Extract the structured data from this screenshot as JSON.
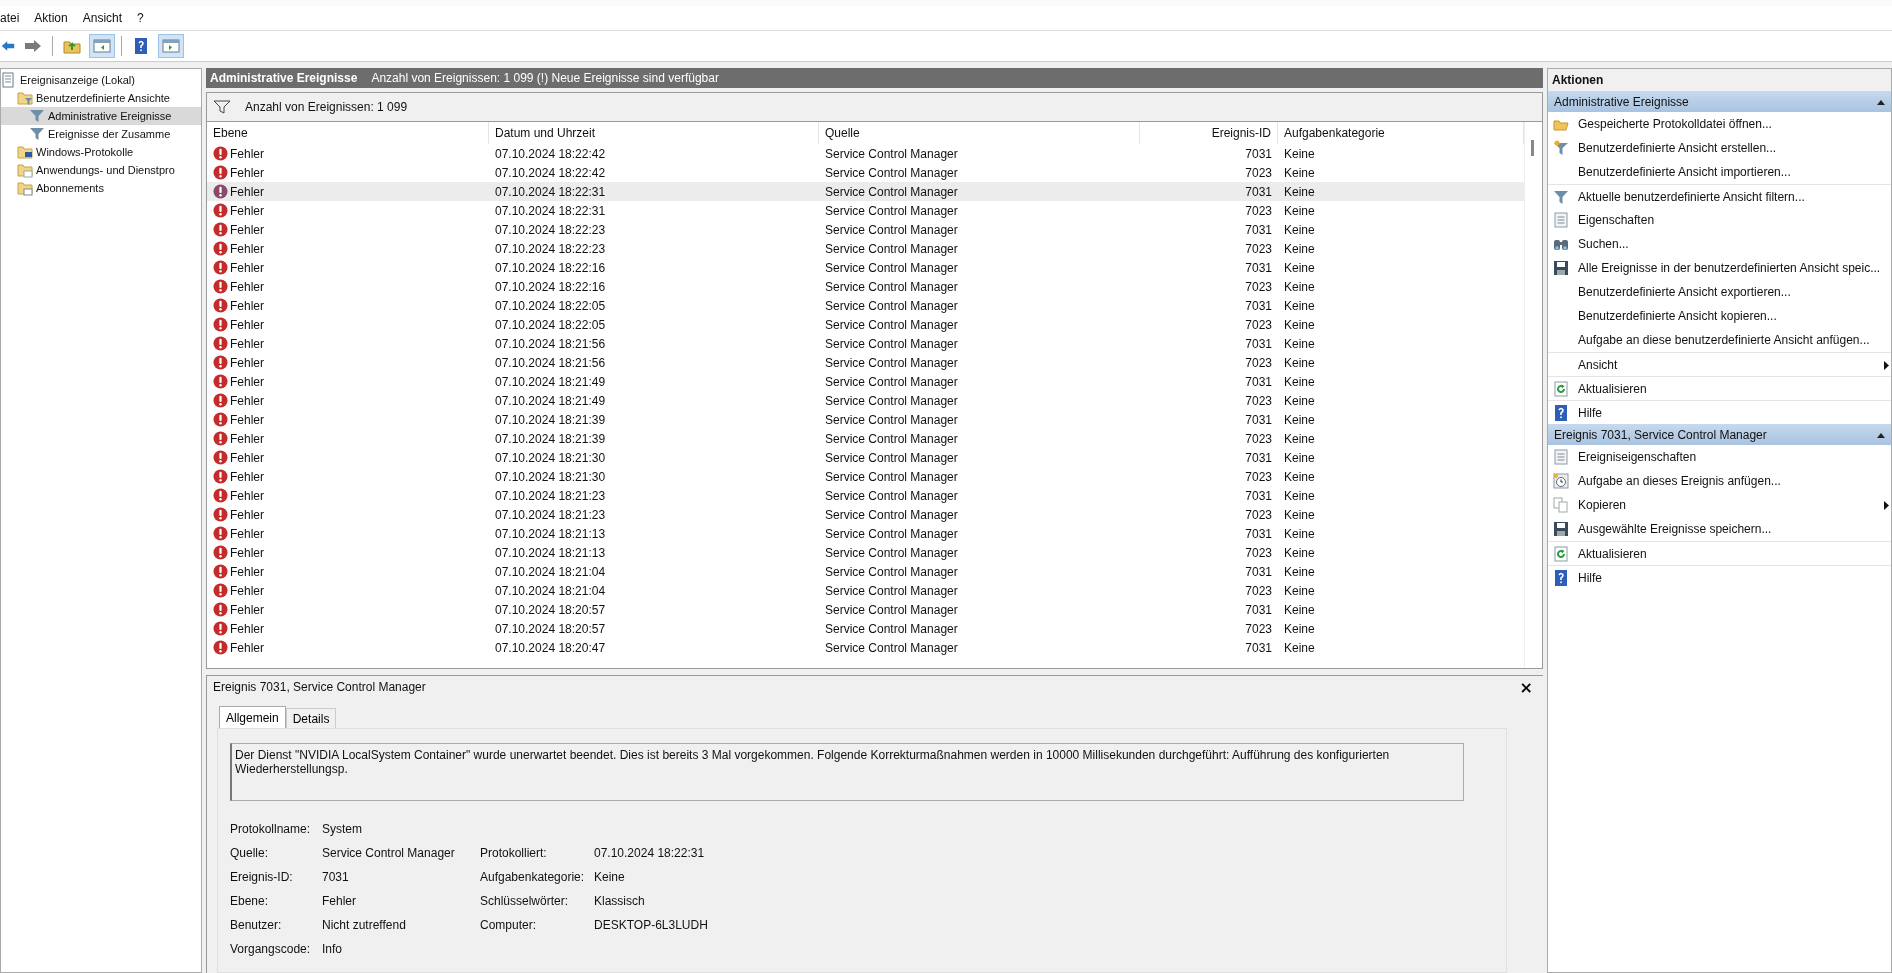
{
  "menu": [
    "atei",
    "Aktion",
    "Ansicht",
    "?"
  ],
  "toolbar": [
    {
      "kind": "back",
      "pressed": false
    },
    {
      "kind": "forward",
      "pressed": false
    },
    {
      "kind": "folder-up",
      "pressed": false
    },
    {
      "kind": "tree-pane",
      "pressed": true
    },
    {
      "kind": "help",
      "pressed": false
    },
    {
      "kind": "action-pane",
      "pressed": true
    }
  ],
  "tree": [
    {
      "label": "Ereignisanzeige (Lokal)",
      "kind": "log",
      "selected": false,
      "children": [
        {
          "label": "Benutzerdefinierte Ansichte",
          "kind": "folder-funnel",
          "selected": false,
          "children": [
            {
              "label": "Administrative Ereignisse",
              "kind": "funnel",
              "selected": true
            },
            {
              "label": "Ereignisse der Zusamme",
              "kind": "funnel",
              "selected": false
            }
          ]
        },
        {
          "label": "Windows-Protokolle",
          "kind": "folder-pc",
          "selected": false
        },
        {
          "label": "Anwendungs- und Dienstpro",
          "kind": "folder",
          "selected": false
        },
        {
          "label": "Abonnements",
          "kind": "folder-sub",
          "selected": false
        }
      ]
    }
  ],
  "view": {
    "title": "Administrative Ereignisse",
    "info": "Anzahl von Ereignissen: 1 099 (!) Neue Ereignisse sind verfügbar",
    "filter": "Anzahl von Ereignissen: 1 099"
  },
  "table": {
    "columns": [
      "Ebene",
      "Datum und Uhrzeit",
      "Quelle",
      "Ereignis-ID",
      "Aufgabenkategorie"
    ],
    "rows": [
      {
        "ebene": "Fehler",
        "datum": "07.10.2024 18:22:42",
        "quelle": "Service Control Manager",
        "id": "7031",
        "kategorie": "Keine",
        "selected": false
      },
      {
        "ebene": "Fehler",
        "datum": "07.10.2024 18:22:42",
        "quelle": "Service Control Manager",
        "id": "7023",
        "kategorie": "Keine",
        "selected": false
      },
      {
        "ebene": "Fehler",
        "datum": "07.10.2024 18:22:31",
        "quelle": "Service Control Manager",
        "id": "7031",
        "kategorie": "Keine",
        "selected": true
      },
      {
        "ebene": "Fehler",
        "datum": "07.10.2024 18:22:31",
        "quelle": "Service Control Manager",
        "id": "7023",
        "kategorie": "Keine",
        "selected": false
      },
      {
        "ebene": "Fehler",
        "datum": "07.10.2024 18:22:23",
        "quelle": "Service Control Manager",
        "id": "7031",
        "kategorie": "Keine",
        "selected": false
      },
      {
        "ebene": "Fehler",
        "datum": "07.10.2024 18:22:23",
        "quelle": "Service Control Manager",
        "id": "7023",
        "kategorie": "Keine",
        "selected": false
      },
      {
        "ebene": "Fehler",
        "datum": "07.10.2024 18:22:16",
        "quelle": "Service Control Manager",
        "id": "7031",
        "kategorie": "Keine",
        "selected": false
      },
      {
        "ebene": "Fehler",
        "datum": "07.10.2024 18:22:16",
        "quelle": "Service Control Manager",
        "id": "7023",
        "kategorie": "Keine",
        "selected": false
      },
      {
        "ebene": "Fehler",
        "datum": "07.10.2024 18:22:05",
        "quelle": "Service Control Manager",
        "id": "7031",
        "kategorie": "Keine",
        "selected": false
      },
      {
        "ebene": "Fehler",
        "datum": "07.10.2024 18:22:05",
        "quelle": "Service Control Manager",
        "id": "7023",
        "kategorie": "Keine",
        "selected": false
      },
      {
        "ebene": "Fehler",
        "datum": "07.10.2024 18:21:56",
        "quelle": "Service Control Manager",
        "id": "7031",
        "kategorie": "Keine",
        "selected": false
      },
      {
        "ebene": "Fehler",
        "datum": "07.10.2024 18:21:56",
        "quelle": "Service Control Manager",
        "id": "7023",
        "kategorie": "Keine",
        "selected": false
      },
      {
        "ebene": "Fehler",
        "datum": "07.10.2024 18:21:49",
        "quelle": "Service Control Manager",
        "id": "7031",
        "kategorie": "Keine",
        "selected": false
      },
      {
        "ebene": "Fehler",
        "datum": "07.10.2024 18:21:49",
        "quelle": "Service Control Manager",
        "id": "7023",
        "kategorie": "Keine",
        "selected": false
      },
      {
        "ebene": "Fehler",
        "datum": "07.10.2024 18:21:39",
        "quelle": "Service Control Manager",
        "id": "7031",
        "kategorie": "Keine",
        "selected": false
      },
      {
        "ebene": "Fehler",
        "datum": "07.10.2024 18:21:39",
        "quelle": "Service Control Manager",
        "id": "7023",
        "kategorie": "Keine",
        "selected": false
      },
      {
        "ebene": "Fehler",
        "datum": "07.10.2024 18:21:30",
        "quelle": "Service Control Manager",
        "id": "7031",
        "kategorie": "Keine",
        "selected": false
      },
      {
        "ebene": "Fehler",
        "datum": "07.10.2024 18:21:30",
        "quelle": "Service Control Manager",
        "id": "7023",
        "kategorie": "Keine",
        "selected": false
      },
      {
        "ebene": "Fehler",
        "datum": "07.10.2024 18:21:23",
        "quelle": "Service Control Manager",
        "id": "7031",
        "kategorie": "Keine",
        "selected": false
      },
      {
        "ebene": "Fehler",
        "datum": "07.10.2024 18:21:23",
        "quelle": "Service Control Manager",
        "id": "7023",
        "kategorie": "Keine",
        "selected": false
      },
      {
        "ebene": "Fehler",
        "datum": "07.10.2024 18:21:13",
        "quelle": "Service Control Manager",
        "id": "7031",
        "kategorie": "Keine",
        "selected": false
      },
      {
        "ebene": "Fehler",
        "datum": "07.10.2024 18:21:13",
        "quelle": "Service Control Manager",
        "id": "7023",
        "kategorie": "Keine",
        "selected": false
      },
      {
        "ebene": "Fehler",
        "datum": "07.10.2024 18:21:04",
        "quelle": "Service Control Manager",
        "id": "7031",
        "kategorie": "Keine",
        "selected": false
      },
      {
        "ebene": "Fehler",
        "datum": "07.10.2024 18:21:04",
        "quelle": "Service Control Manager",
        "id": "7023",
        "kategorie": "Keine",
        "selected": false
      },
      {
        "ebene": "Fehler",
        "datum": "07.10.2024 18:20:57",
        "quelle": "Service Control Manager",
        "id": "7031",
        "kategorie": "Keine",
        "selected": false
      },
      {
        "ebene": "Fehler",
        "datum": "07.10.2024 18:20:57",
        "quelle": "Service Control Manager",
        "id": "7023",
        "kategorie": "Keine",
        "selected": false
      },
      {
        "ebene": "Fehler",
        "datum": "07.10.2024 18:20:47",
        "quelle": "Service Control Manager",
        "id": "7031",
        "kategorie": "Keine",
        "selected": false
      }
    ]
  },
  "details": {
    "title": "Ereignis 7031, Service Control Manager",
    "close": "×",
    "tabs": [
      {
        "label": "Allgemein",
        "selected": true
      },
      {
        "label": "Details",
        "selected": false
      }
    ],
    "description": "Der Dienst \"NVIDIA LocalSystem Container\" wurde unerwartet beendet. Dies ist bereits 3 Mal vorgekommen. Folgende Korrekturmaßnahmen werden in 10000 Millisekunden durchgeführt: Aufführung des konfigurierten Wiederherstellungsp.",
    "fields": [
      {
        "left": {
          "label": "Protokollname:",
          "value": "System"
        }
      },
      {
        "left": {
          "label": "Quelle:",
          "value": "Service Control Manager"
        },
        "right": {
          "label": "Protokolliert:",
          "value": "07.10.2024 18:22:31"
        }
      },
      {
        "left": {
          "label": "Ereignis-ID:",
          "value": "7031"
        },
        "right": {
          "label": "Aufgabenkategorie:",
          "value": "Keine"
        }
      },
      {
        "left": {
          "label": "Ebene:",
          "value": "Fehler"
        },
        "right": {
          "label": "Schlüsselwörter:",
          "value": "Klassisch"
        }
      },
      {
        "left": {
          "label": "Benutzer:",
          "value": "Nicht zutreffend"
        },
        "right": {
          "label": "Computer:",
          "value": "DESKTOP-6L3LUDH"
        }
      },
      {
        "left": {
          "label": "Vorgangscode:",
          "value": "Info"
        }
      }
    ]
  },
  "actions": {
    "title": "Aktionen",
    "sections": [
      {
        "title": "Administrative Ereignisse",
        "expanded": true,
        "items": [
          {
            "label": "Gespeicherte Protokolldatei öffnen...",
            "kind": "folder",
            "separator_before": false,
            "submenu": false
          },
          {
            "label": "Benutzerdefinierte Ansicht erstellen...",
            "kind": "funnel-new",
            "separator_before": false,
            "submenu": false
          },
          {
            "label": "Benutzerdefinierte Ansicht importieren...",
            "kind": "plain",
            "separator_before": false,
            "submenu": false
          },
          {
            "label": "Aktuelle benutzerdefinierte Ansicht filtern...",
            "kind": "funnel",
            "separator_before": true,
            "submenu": false
          },
          {
            "label": "Eigenschaften",
            "kind": "properties",
            "separator_before": false,
            "submenu": false
          },
          {
            "label": "Suchen...",
            "kind": "binoculars",
            "separator_before": false,
            "submenu": false
          },
          {
            "label": "Alle Ereignisse in der benutzerdefinierten Ansicht speic...",
            "kind": "disk",
            "separator_before": false,
            "submenu": false
          },
          {
            "label": "Benutzerdefinierte Ansicht exportieren...",
            "kind": "plain",
            "separator_before": false,
            "submenu": false
          },
          {
            "label": "Benutzerdefinierte Ansicht kopieren...",
            "kind": "plain",
            "separator_before": false,
            "submenu": false
          },
          {
            "label": "Aufgabe an diese benutzerdefinierte Ansicht anfügen...",
            "kind": "plain",
            "separator_before": false,
            "submenu": false
          },
          {
            "label": "Ansicht",
            "kind": "plain",
            "separator_before": true,
            "submenu": true
          },
          {
            "label": "Aktualisieren",
            "kind": "refresh",
            "separator_before": true,
            "submenu": false
          },
          {
            "label": "Hilfe",
            "kind": "help",
            "separator_before": true,
            "submenu": false
          }
        ]
      },
      {
        "title": "Ereignis 7031, Service Control Manager",
        "expanded": true,
        "items": [
          {
            "label": "Ereigniseigenschaften",
            "kind": "properties",
            "separator_before": false,
            "submenu": false
          },
          {
            "label": "Aufgabe an dieses Ereignis anfügen...",
            "kind": "task",
            "separator_before": false,
            "submenu": false
          },
          {
            "label": "Kopieren",
            "kind": "copy",
            "separator_before": false,
            "submenu": true
          },
          {
            "label": "Ausgewählte Ereignisse speichern...",
            "kind": "disk",
            "separator_before": false,
            "submenu": false
          },
          {
            "label": "Aktualisieren",
            "kind": "refresh",
            "separator_before": true,
            "submenu": false
          },
          {
            "label": "Hilfe",
            "kind": "help",
            "separator_before": true,
            "submenu": false
          }
        ]
      }
    ]
  }
}
